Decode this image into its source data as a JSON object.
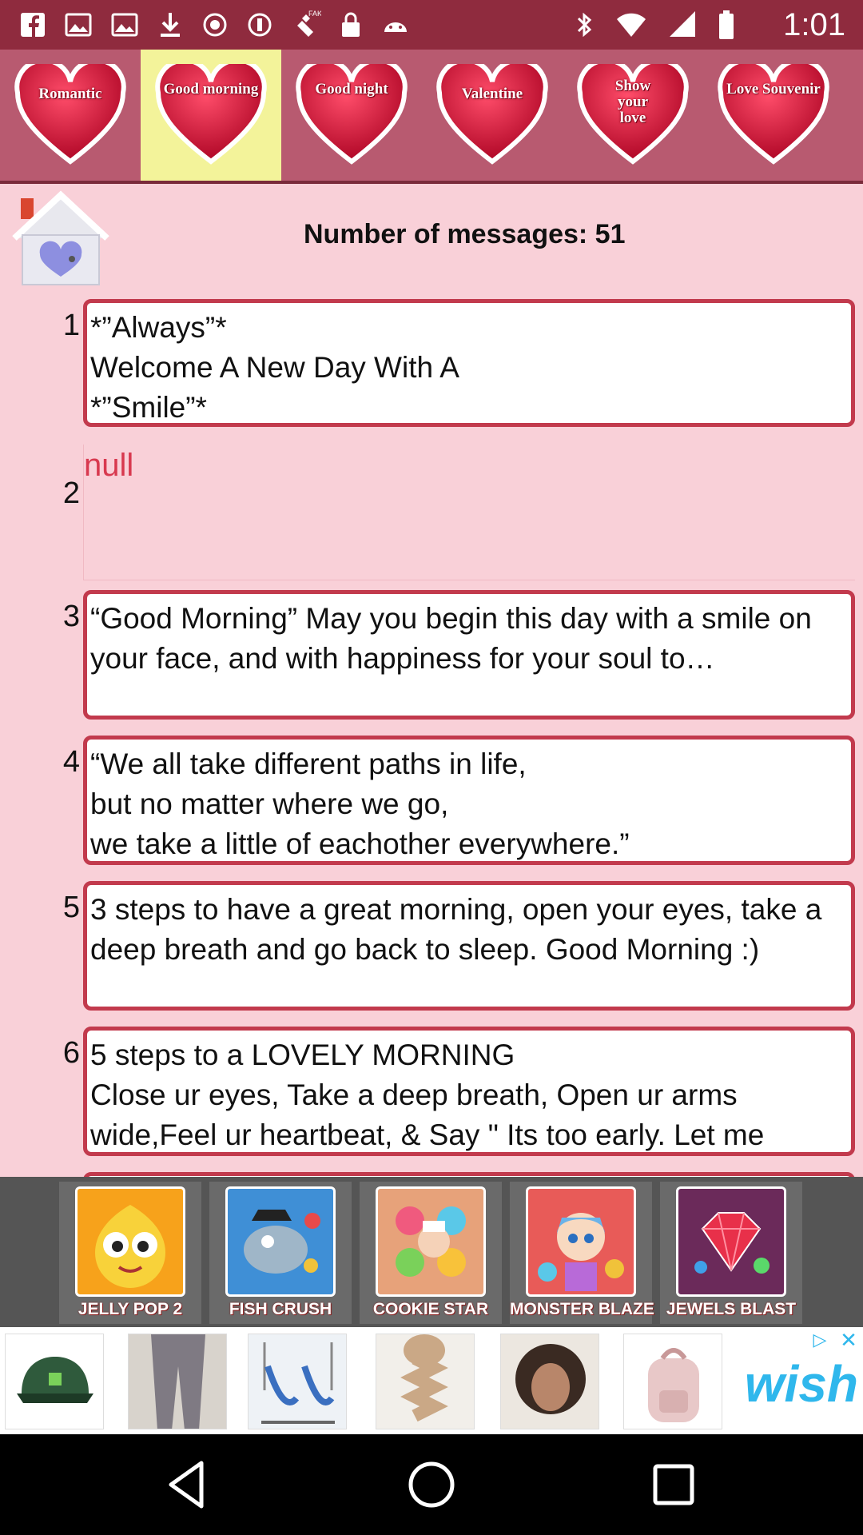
{
  "status_bar": {
    "time": "1:01",
    "left_icons": [
      "facebook-icon",
      "image-icon",
      "image-icon",
      "download-icon",
      "record-icon",
      "record-icon",
      "fake-gps-icon",
      "lock-icon",
      "android-icon"
    ],
    "right_icons": [
      "bluetooth-icon",
      "wifi-icon",
      "signal-icon",
      "battery-icon"
    ]
  },
  "categories": [
    {
      "label": "Romantic",
      "active": false
    },
    {
      "label": "Good morning",
      "active": true
    },
    {
      "label": "Good night",
      "active": false
    },
    {
      "label": "Valentine",
      "active": false
    },
    {
      "label": "Show your love",
      "active": false
    },
    {
      "label": "Love Souvenir",
      "active": false
    }
  ],
  "header": {
    "message_count_label": "Number of messages: 51"
  },
  "messages": [
    {
      "num": "1",
      "text": "*”Always”*\nWelcome A New Day With A\n*”Smile”*"
    },
    {
      "num": "2",
      "text": "null"
    },
    {
      "num": "3",
      "text": "“Good Morning” May you begin this day with a smile on your face, and with happiness for your soul to…"
    },
    {
      "num": "4",
      "text": "“We all take different paths in life,\nbut no matter where we go,\nwe take a little of eachother everywhere.”"
    },
    {
      "num": "5",
      "text": "3 steps to have a great morning, open your eyes, take a deep breath and go back to sleep. Good Morning :)"
    },
    {
      "num": "6",
      "text": "5 steps to a LOVELY MORNING\nClose ur eyes, Take a deep breath, Open ur arms wide,Feel ur heartbeat, & Say \" Its too early. Let me"
    }
  ],
  "games": [
    {
      "name": "JELLY POP 2",
      "color": "#f7a21b"
    },
    {
      "name": "FISH CRUSH",
      "color": "#3f8fd6"
    },
    {
      "name": "COOKIE STAR",
      "color": "#e7a27a"
    },
    {
      "name": "MONSTER BLAZE",
      "color": "#e85b58"
    },
    {
      "name": "JEWELS BLAST",
      "color": "#6b2a5a"
    }
  ],
  "ad": {
    "brand": "wish",
    "items": [
      "cap-icon",
      "leggings-icon",
      "hammock-chair-icon",
      "braid-icon",
      "hair-icon",
      "backpack-icon"
    ]
  },
  "colors": {
    "accent": "#c23a4d",
    "background": "#f9d0d8",
    "active_tab": "#f3f39a",
    "category_bar": "#b85a70"
  }
}
